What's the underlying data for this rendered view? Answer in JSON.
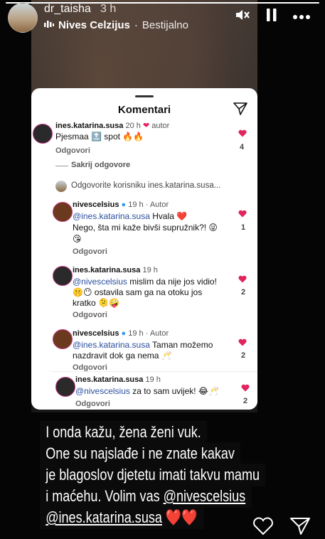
{
  "story": {
    "progress": 1.0,
    "username": "dr_taisha",
    "time": "3 h",
    "music_artist": "Nives Celzijus",
    "music_separator": "·",
    "music_song": "Bestijalno",
    "icons": [
      "mute-icon",
      "pause-icon",
      "more-icon"
    ]
  },
  "card": {
    "title": "Komentari",
    "comments": [
      {
        "user": "ines.katarina.susa",
        "time": "20 h",
        "badge": "autor",
        "text": "Pjesmaa 🔝 spot 🔥🔥",
        "reply": "Odgovori",
        "likes": "4"
      },
      {
        "hide_replies": "Sakrij odgovore"
      },
      {
        "reply_prompt": "Odgovorite korisniku ines.katarina.susa..."
      },
      {
        "user": "nivescelsius",
        "time": "19 h",
        "badge": "Autor",
        "mention": "@ines.katarina.susa",
        "text": "Hvala ❤️",
        "text2": "Nego, šta mi kaže bivši supružnik?! 😜",
        "text3": "😘",
        "reply": "Odgovori",
        "likes": "1"
      },
      {
        "user": "ines.katarina.susa",
        "time": "19 h",
        "mention": "@nivescelsius",
        "text": "mislim da nije jos vidio!",
        "text2": "🤫😶 ostavila sam ga na otoku jos",
        "text3": "kratko 🫠🤪",
        "reply": "Odgovori",
        "likes": "2"
      },
      {
        "user": "nivescelsius",
        "time": "19 h",
        "badge": "Autor",
        "mention": "@ines.katarina.susa",
        "text": "Taman možemo",
        "text2": "nazdravit dok ga nema 🥂",
        "reply": "Odgovori",
        "likes": "2"
      },
      {
        "user": "ines.katarina.susa",
        "time": "19 h",
        "mention": "@nivescelsius",
        "text": "za to sam uvijek! 😂🥂",
        "reply": "Odgovori",
        "likes": "2"
      }
    ]
  },
  "caption": {
    "line1": "I onda kažu, žena ženi vuk.",
    "line2": "One su najslađe i ne znate kakav",
    "line3": "je blagoslov djetetu  imati takvu mamu",
    "line4_pre": "i maćehu. Volim vas ",
    "line4_tag": "@nivescelsius",
    "line5_tag": "@ines.katarina.susa",
    "line5_post": " ❤️❤️"
  },
  "colors": {
    "heart": "#e0245e",
    "mention": "#2b4e9e",
    "caption_bg": "#0b0b0b"
  }
}
